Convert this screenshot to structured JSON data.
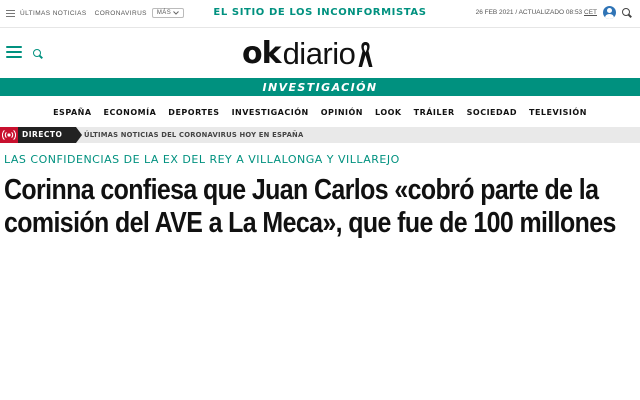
{
  "topbar": {
    "breaking_label": "ÚLTIMAS NOTICIAS",
    "coronavirus_label": "CORONAVIRUS",
    "more_label": "MÁS",
    "slogan": "EL SITIO DE LOS INCONFORMISTAS",
    "date": "26 FEB 2021",
    "updated_label": "/ ACTUALIZADO 08:53",
    "timezone": "CET"
  },
  "header": {
    "logo_ok": "ok",
    "logo_diario": "diario"
  },
  "section": {
    "title": "INVESTIGACIÓN"
  },
  "nav": {
    "items": [
      "ESPAÑA",
      "ECONOMÍA",
      "DEPORTES",
      "INVESTIGACIÓN",
      "OPINIÓN",
      "LOOK",
      "TRÁILER",
      "SOCIEDAD",
      "TELEVISIÓN"
    ]
  },
  "live": {
    "label": "DIRECTO",
    "text": "ÚLTIMAS NOTICIAS DEL CORONAVIRUS HOY EN ESPAÑA"
  },
  "article": {
    "kicker": "LAS CONFIDENCIAS DE LA EX DEL REY A VILLALONGA Y VILLAREJO",
    "headline": "Corinna confiesa que Juan Carlos «cobró parte de la comisión del AVE a La Meca», que fue de 100 millones"
  },
  "colors": {
    "brand_teal": "#00917f",
    "live_red": "#c8102e",
    "user_blue": "#2f74b6"
  },
  "icons": {
    "menu": "hamburger-menu-icon",
    "search": "search-icon",
    "user": "user-account-icon",
    "mourning": "mourning-ribbon-icon",
    "live": "live-broadcast-icon"
  }
}
